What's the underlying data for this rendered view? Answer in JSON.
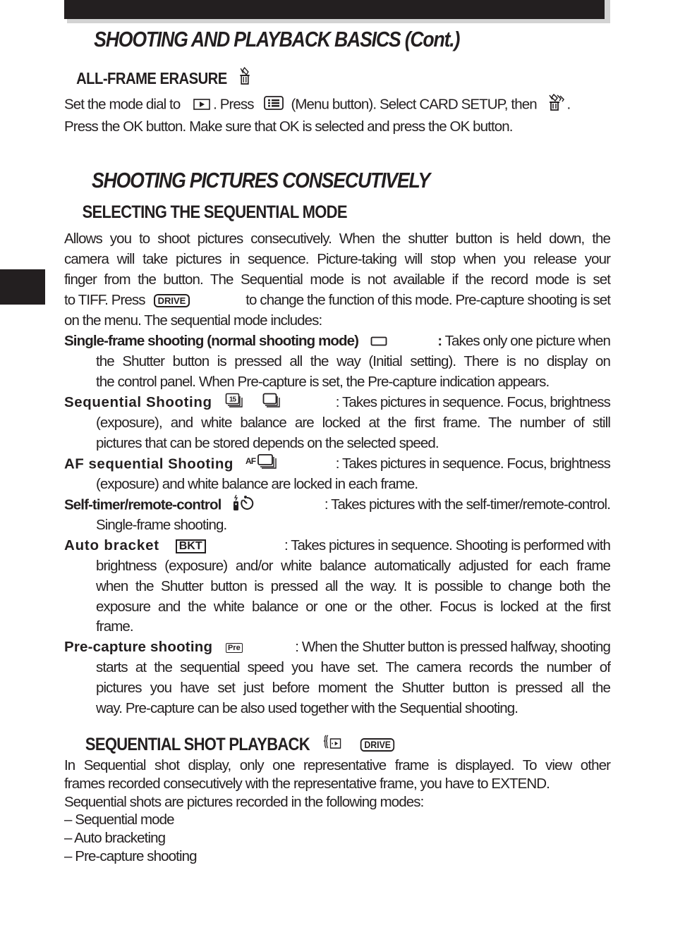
{
  "header": {
    "title": "SHOOTING AND PLAYBACK BASICS (Cont.)"
  },
  "all_frame_erasure": {
    "heading": "ALL-FRAME ERASURE",
    "heading_icon": "trash-all-icon",
    "line1_a": "Set the mode dial to",
    "line1_icon1": "playback-icon",
    "line1_b": ". Press",
    "line1_icon2": "menu-button-icon",
    "line1_c": "(Menu button). Select CARD SETUP, then",
    "line1_icon3": "erase-all-icon",
    "line1_d": ".",
    "line2": "Press the OK button. Make sure that OK is selected and press the OK button."
  },
  "consecutive": {
    "title": "SHOOTING PICTURES CONSECUTIVELY",
    "subheading": "SELECTING THE SEQUENTIAL MODE",
    "intro_lines": [
      "Allows you to shoot pictures consecutively. When the shutter button is held down, the",
      "camera will take pictures in sequence.  Picture-taking will stop when you release your",
      "finger from the button.  The Sequential mode is not available if the record mode is set"
    ],
    "intro_line4_a": "to TIFF.  Press",
    "drive_label": "DRIVE",
    "intro_line4_b": "to change the function of this mode. Pre-capture shooting is set",
    "intro_line5": "on the menu. The sequential mode includes:",
    "modes": [
      {
        "term": "Single-frame shooting (normal shooting mode)",
        "icon": "single-frame-icon",
        "first": ": Takes only one picture when",
        "rest": [
          "the Shutter button is pressed all the way (Initial setting). There is no display on",
          "the control panel. When Pre-capture is set, the Pre-capture indication appears."
        ]
      },
      {
        "term": "Sequential Shooting",
        "icon": "sequential-15-icon",
        "icon_text": "15",
        "icon2": "sequential-icon",
        "first": ": Takes pictures in sequence.  Focus, brightness",
        "rest": [
          "(exposure), and white balance are locked at the first frame.  The number of still",
          "pictures that can be stored depends on the selected speed."
        ]
      },
      {
        "term": "AF sequential Shooting",
        "icon": "af-sequential-icon",
        "icon_text": "AF",
        "first": ": Takes pictures in sequence. Focus, brightness",
        "rest": [
          "(exposure) and white balance are locked in each frame."
        ]
      },
      {
        "term": "Self-timer/remote-control",
        "icon": "self-timer-remote-icon",
        "first": ": Takes pictures with the self-timer/remote-control.",
        "rest": [
          "Single-frame shooting."
        ]
      },
      {
        "term": "Auto bracket",
        "icon": "bkt-icon",
        "icon_text": "BKT",
        "first": ": Takes pictures in sequence. Shooting is performed with",
        "rest": [
          "brightness (exposure) and/or white balance automatically adjusted for each frame",
          "when the Shutter button is pressed all the way. It is possible to change both the",
          "exposure and the white balance or one or the other. Focus is locked at the first",
          "frame."
        ]
      },
      {
        "term": "Pre-capture shooting",
        "icon": "pre-capture-icon",
        "icon_text": "Pre",
        "first": ": When the Shutter button is pressed halfway, shooting",
        "rest": [
          "starts at the sequential speed you have set. The camera records the number of",
          "pictures you have set just before moment the Shutter button is pressed all the",
          "way. Pre-capture can be also used together with the Sequential shooting."
        ]
      }
    ]
  },
  "playback": {
    "heading": "SEQUENTIAL SHOT PLAYBACK",
    "icon": "sequential-playback-icon",
    "drive_label": "DRIVE",
    "lines": [
      "In Sequential shot display, only one representative frame is displayed. To view other",
      "frames recorded consecutively with the representative frame, you have to EXTEND.",
      "Sequential shots are pictures recorded in the following modes:"
    ],
    "list": [
      "– Sequential mode",
      "– Auto bracketing",
      "– Pre-capture shooting"
    ]
  }
}
